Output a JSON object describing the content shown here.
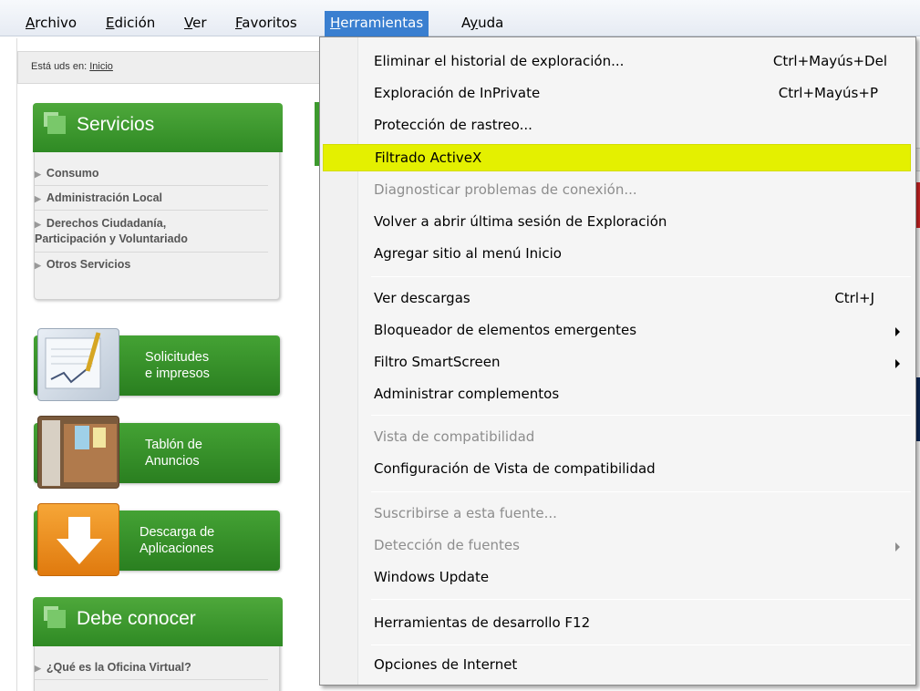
{
  "menubar": {
    "items": [
      {
        "label": "Archivo",
        "key": "A",
        "rest": "rchivo"
      },
      {
        "label": "Edición",
        "key": "E",
        "rest": "dición"
      },
      {
        "label": "Ver",
        "key": "V",
        "rest": "er"
      },
      {
        "label": "Favoritos",
        "key": "F",
        "rest": "avoritos"
      },
      {
        "label": "Herramientas",
        "key": "H",
        "rest": "erramientas"
      },
      {
        "label": "Ayuda",
        "pre": "A",
        "key": "y",
        "rest": "uda"
      }
    ]
  },
  "page": {
    "breadcrumb_prefix": "Está uds en:",
    "breadcrumb_link": "Inicio",
    "servicios": {
      "title": "Servicios",
      "items": [
        "Consumo",
        "Administración Local",
        "Derechos Ciudadanía,\nParticipación y Voluntariado",
        "Otros Servicios"
      ]
    },
    "tiles": [
      {
        "label": "Solicitudes\ne impresos"
      },
      {
        "label": "Tablón de\nAnuncios"
      },
      {
        "label": "Descarga de\nAplicaciones"
      }
    ],
    "debe_conocer": {
      "title": "Debe conocer",
      "items": [
        "¿Qué es la Oficina Virtual?"
      ]
    }
  },
  "dropdown": {
    "items": [
      {
        "label": "Eliminar el historial de exploración...",
        "shortcut": "Ctrl+Mayús+Del"
      },
      {
        "label": "Exploración de InPrivate",
        "shortcut": "Ctrl+Mayús+P"
      },
      {
        "label": "Protección de rastreo..."
      },
      {
        "label": "Filtrado ActiveX"
      },
      {
        "label": "Diagnosticar problemas de conexión..."
      },
      {
        "label": "Volver a abrir última sesión de Exploración"
      },
      {
        "label": "Agregar sitio al menú Inicio"
      },
      {
        "label": "Ver descargas",
        "shortcut": "Ctrl+J"
      },
      {
        "label": "Bloqueador de elementos emergentes"
      },
      {
        "label": "Filtro SmartScreen"
      },
      {
        "label": "Administrar complementos"
      },
      {
        "label": "Vista de compatibilidad"
      },
      {
        "label": "Configuración de Vista de compatibilidad"
      },
      {
        "label": "Suscribirse a esta fuente..."
      },
      {
        "label": "Detección de fuentes"
      },
      {
        "label": "Windows Update"
      },
      {
        "label": "Herramientas de desarrollo F12"
      },
      {
        "label": "Opciones de Internet"
      }
    ]
  }
}
